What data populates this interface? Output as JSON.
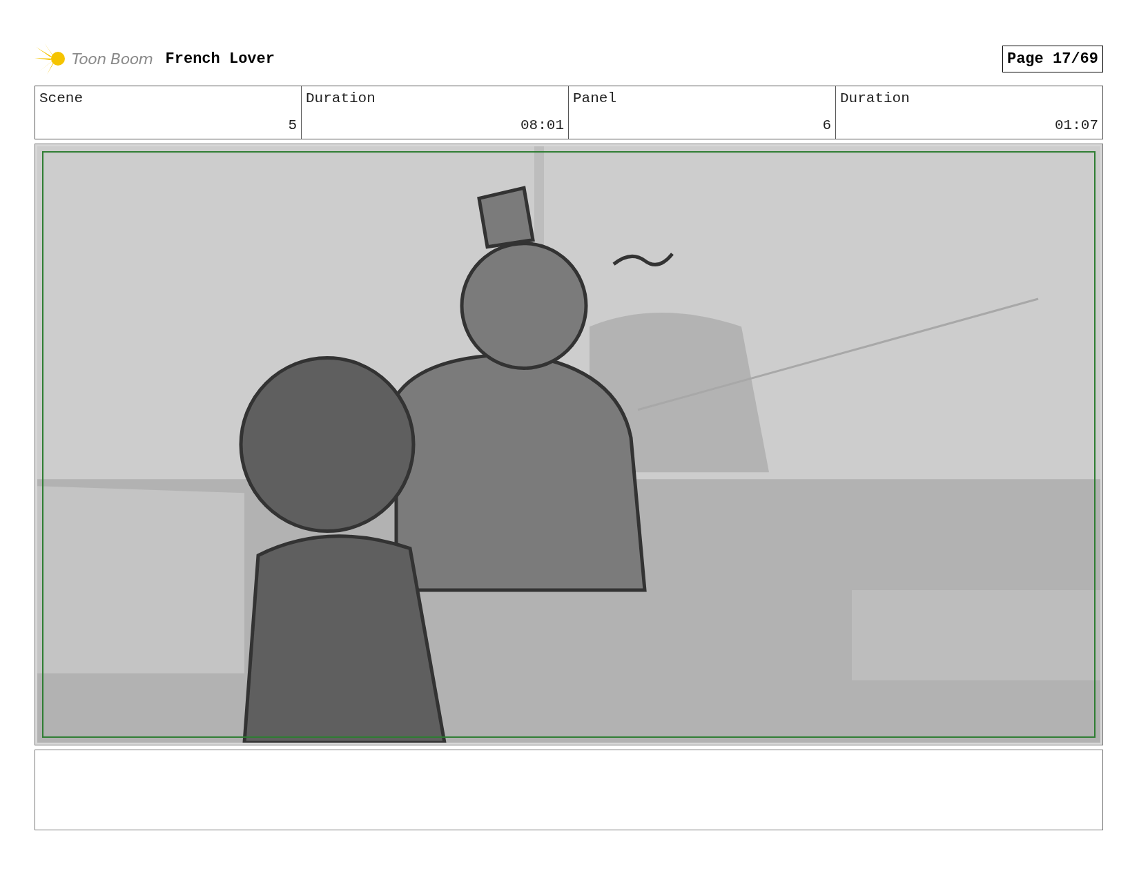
{
  "header": {
    "logo": "Toon Boom",
    "title": "French Lover",
    "page": "Page 17/69"
  },
  "info_table": {
    "columns": [
      "Scene",
      "Duration",
      "Panel",
      "Duration"
    ],
    "rows": [
      [
        "5",
        "08:01",
        "6",
        "01:07"
      ]
    ]
  }
}
